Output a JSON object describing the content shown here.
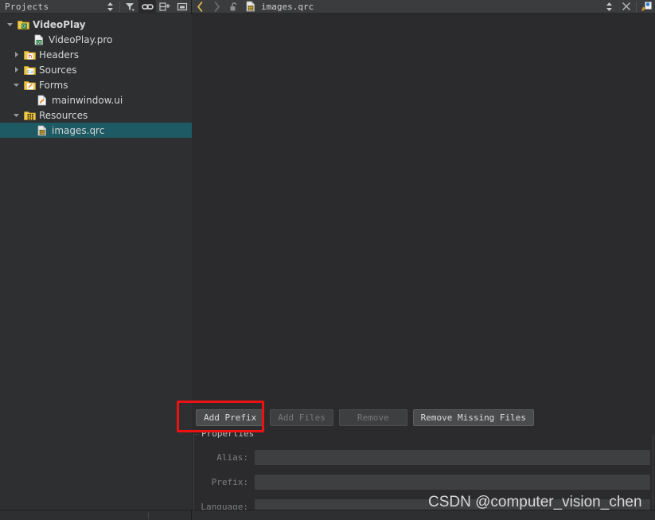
{
  "panel": {
    "title": "Projects",
    "tools": [
      {
        "name": "sync-selector-icon",
        "icon": "updown-arrows"
      },
      {
        "name": "filter-icon",
        "icon": "funnel"
      },
      {
        "name": "link-with-editor-icon",
        "icon": "chain-link",
        "active": true
      },
      {
        "name": "add-split-icon",
        "icon": "pane-plus"
      },
      {
        "name": "collapse-panel-icon",
        "icon": "minimize-box"
      }
    ]
  },
  "tree": [
    {
      "label": "VideoPlay",
      "depth": 0,
      "twisty": "down",
      "icon": "folder-qt",
      "bold": true,
      "selected": false
    },
    {
      "label": "VideoPlay.pro",
      "depth": 1,
      "twisty": "none",
      "icon": "file-qt",
      "bold": false,
      "selected": false
    },
    {
      "label": "Headers",
      "depth": 1,
      "twisty": "right",
      "icon": "folder-h",
      "bold": false,
      "selected": false
    },
    {
      "label": "Sources",
      "depth": 1,
      "twisty": "right",
      "icon": "folder-cpp",
      "bold": false,
      "selected": false
    },
    {
      "label": "Forms",
      "depth": 1,
      "twisty": "down",
      "icon": "folder-form",
      "bold": false,
      "selected": false
    },
    {
      "label": "mainwindow.ui",
      "depth": 2,
      "twisty": "none",
      "icon": "file-form",
      "bold": false,
      "selected": false
    },
    {
      "label": "Resources",
      "depth": 1,
      "twisty": "down",
      "icon": "folder-qrc",
      "bold": false,
      "selected": false
    },
    {
      "label": "images.qrc",
      "depth": 2,
      "twisty": "none",
      "icon": "file-qrc",
      "bold": false,
      "selected": true
    }
  ],
  "editor_toolbar": {
    "back_label": "‹",
    "forward_label": "›",
    "lock_icon": "unlocked-padlock-icon",
    "file_icon": "qrc-file-icon",
    "filename": "images.qrc",
    "updown_icon": "updown-arrows-icon",
    "close_icon": "close-icon",
    "split_icon": "split-editor-icon"
  },
  "buttons": [
    {
      "label": "Add Prefix",
      "enabled": true,
      "name": "add-prefix-button"
    },
    {
      "label": "Add Files",
      "enabled": false,
      "name": "add-files-button"
    },
    {
      "label": "Remove",
      "enabled": false,
      "name": "remove-button"
    },
    {
      "label": "Remove Missing Files",
      "enabled": true,
      "name": "remove-missing-files-button"
    }
  ],
  "properties": {
    "title": "Properties",
    "fields": [
      {
        "label": "Alias:",
        "value": "",
        "name": "alias-field"
      },
      {
        "label": "Prefix:",
        "value": "",
        "name": "prefix-field"
      },
      {
        "label": "Language:",
        "value": "",
        "name": "language-field"
      }
    ]
  },
  "annotation": {
    "color": "#ee1111",
    "target": "Add Prefix"
  },
  "watermark": {
    "text": "CSDN @computer_vision_chen"
  },
  "colors": {
    "panel_bg": "#2e2f31",
    "editor_bg": "#2b2b2d",
    "toolbar_bg": "#3b3c3e",
    "selection": "#1d5a63",
    "button_bg": "#4a4b4d",
    "input_bg": "#3e3f41",
    "text": "#d6d6d6",
    "text_disabled": "#77787a",
    "accent_yellow": "#e8c252",
    "annotation_red": "#ee1111"
  }
}
